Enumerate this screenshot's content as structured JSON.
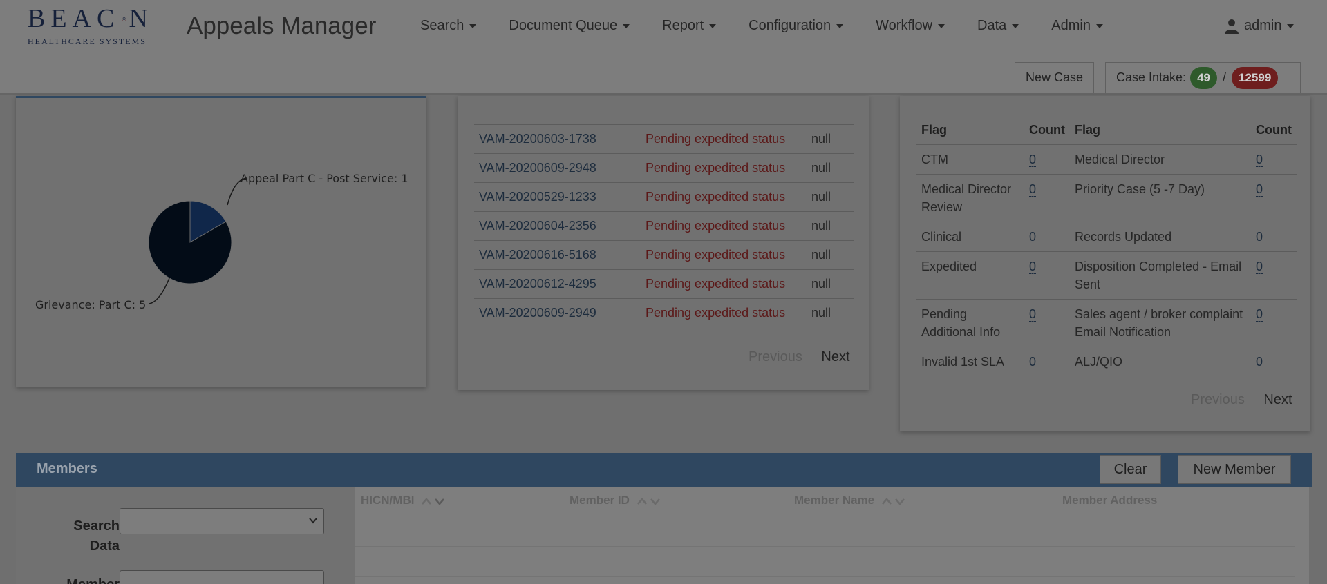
{
  "header": {
    "logo_text": "BEACON",
    "logo_subtext": "HEALTHCARE SYSTEMS",
    "app_title": "Appeals Manager",
    "nav": [
      "Search",
      "Document Queue",
      "Report",
      "Configuration",
      "Workflow",
      "Data",
      "Admin"
    ],
    "user": "admin",
    "new_case_label": "New Case",
    "intake_label": "Case Intake:",
    "intake_green": "49",
    "intake_slash": "/",
    "intake_red": "12599"
  },
  "pie": {
    "label_appeal": "Appeal Part C - Post Service: 1",
    "label_grievance": "Grievance: Part C: 5",
    "colors": {
      "appeal": "#10274a",
      "grievance": "#030c17"
    }
  },
  "chart_data": {
    "type": "pie",
    "categories": [
      "Appeal Part C - Post Service",
      "Grievance: Part C"
    ],
    "values": [
      1,
      5
    ]
  },
  "cases": {
    "rows": [
      {
        "id": "VAM-20200603-1738",
        "status": "Pending expedited status",
        "value": "null"
      },
      {
        "id": "VAM-20200609-2948",
        "status": "Pending expedited status",
        "value": "null"
      },
      {
        "id": "VAM-20200529-1233",
        "status": "Pending expedited status",
        "value": "null"
      },
      {
        "id": "VAM-20200604-2356",
        "status": "Pending expedited status",
        "value": "null"
      },
      {
        "id": "VAM-20200616-5168",
        "status": "Pending expedited status",
        "value": "null"
      },
      {
        "id": "VAM-20200612-4295",
        "status": "Pending expedited status",
        "value": "null"
      },
      {
        "id": "VAM-20200609-2949",
        "status": "Pending expedited status",
        "value": "null"
      }
    ],
    "previous": "Previous",
    "next": "Next"
  },
  "flags": {
    "headers": [
      "Flag",
      "Count",
      "Flag",
      "Count"
    ],
    "rows": [
      {
        "f1": "CTM",
        "c1": "0",
        "f2": "Medical Director",
        "c2": "0"
      },
      {
        "f1": "Medical Director Review",
        "c1": "0",
        "f2": "Priority Case (5 -7 Day)",
        "c2": "0"
      },
      {
        "f1": "Clinical",
        "c1": "0",
        "f2": "Records Updated",
        "c2": "0"
      },
      {
        "f1": "Expedited",
        "c1": "0",
        "f2": "Disposition Completed - Email Sent",
        "c2": "0"
      },
      {
        "f1": "Pending Additional Info",
        "c1": "0",
        "f2": "Sales agent / broker complaint Email Notification",
        "c2": "0"
      },
      {
        "f1": "Invalid 1st SLA",
        "c1": "0",
        "f2": "ALJ/QIO",
        "c2": "0"
      }
    ],
    "previous": "Previous",
    "next": "Next"
  },
  "members": {
    "title": "Members",
    "clear": "Clear",
    "new_member": "New Member",
    "search_label": "Search Data",
    "member_label": "Member",
    "columns": [
      "HICN/MBI",
      "Member ID",
      "Member Name",
      "Member Address"
    ]
  }
}
